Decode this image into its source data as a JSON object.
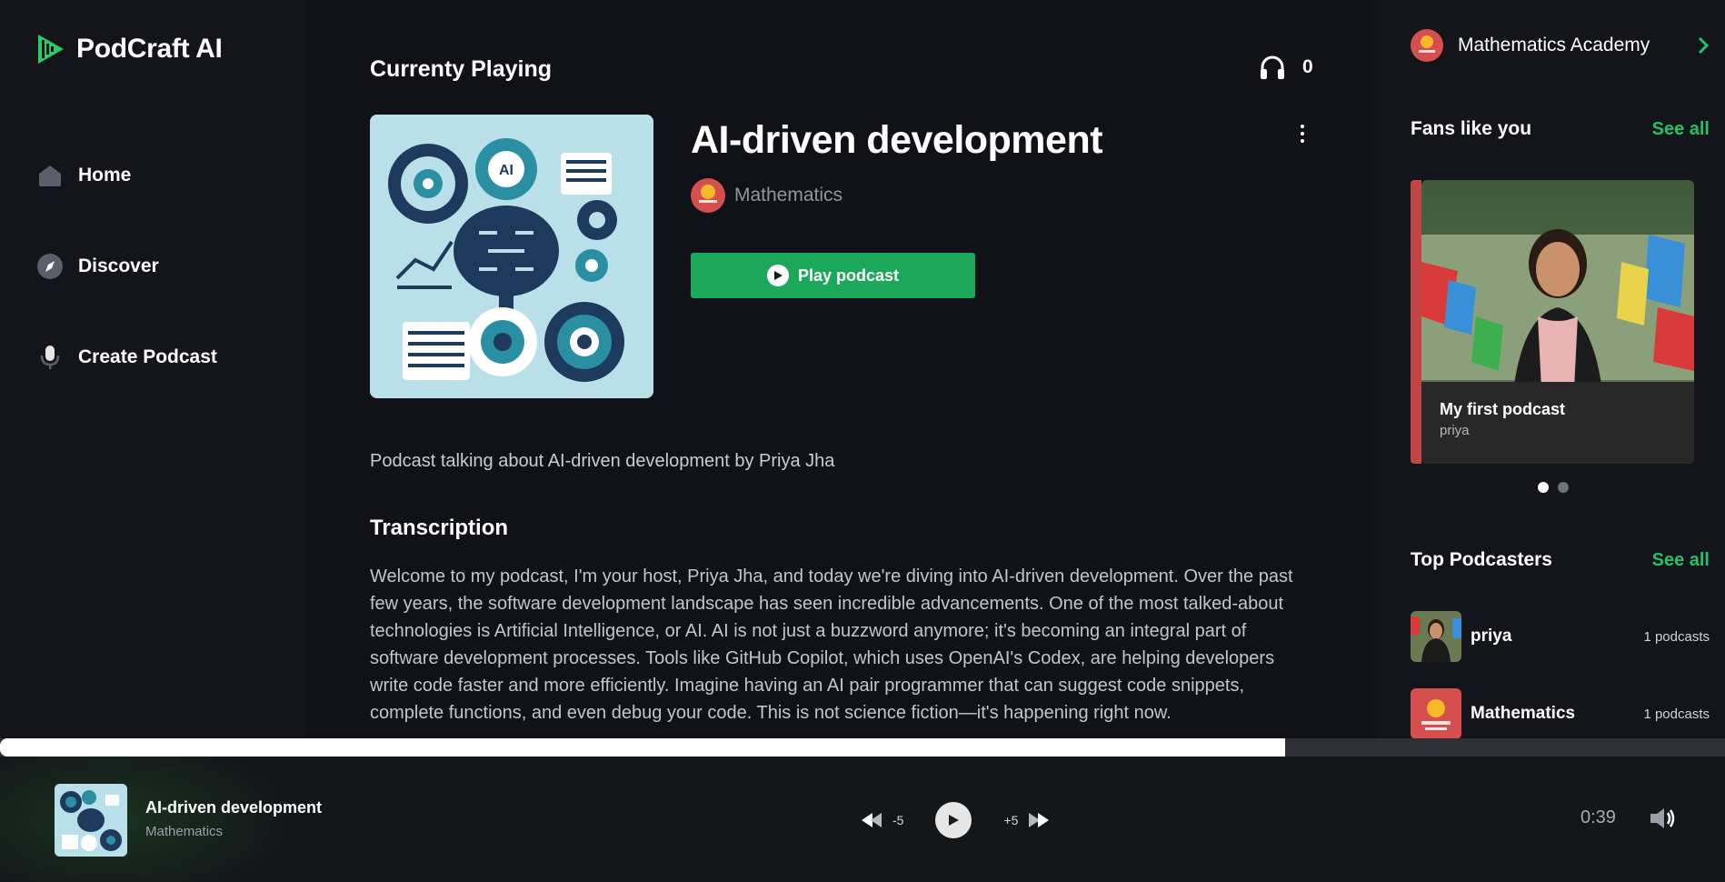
{
  "app": {
    "name": "PodCraft AI"
  },
  "nav": [
    {
      "label": "Home",
      "icon": "home-icon"
    },
    {
      "label": "Discover",
      "icon": "compass-icon"
    },
    {
      "label": "Create Podcast",
      "icon": "microphone-icon"
    }
  ],
  "main": {
    "section_title": "Currenty Playing",
    "listeners": "0",
    "podcast_title": "AI-driven development",
    "author": "Mathematics",
    "play_label": "Play podcast",
    "description": "Podcast talking about AI-driven development by Priya Jha",
    "transcription_title": "Transcription",
    "transcription": "Welcome to my podcast, I'm your host, Priya Jha, and today we're diving into AI-driven development. Over the past few years, the software development landscape has seen incredible advancements. One of the most talked-about technologies is Artificial Intelligence, or AI. AI is not just a buzzword anymore; it's becoming an integral part of software development processes. Tools like GitHub Copilot, which uses OpenAI's Codex, are helping developers write code faster and more efficiently. Imagine having an AI pair programmer that can suggest code snippets, complete functions, and even debug your code. This is not science fiction—it's happening right now."
  },
  "right": {
    "account_name": "Mathematics Academy",
    "fans_title": "Fans like you",
    "fans_see_all": "See all",
    "fan_card": {
      "title": "My first podcast",
      "subtitle": "priya"
    },
    "top_title": "Top Podcasters",
    "top_see_all": "See all",
    "podcasters": [
      {
        "name": "priya",
        "count": "1 podcasts"
      },
      {
        "name": "Mathematics",
        "count": "1 podcasts"
      }
    ]
  },
  "player": {
    "title": "AI-driven development",
    "subtitle": "Mathematics",
    "rewind_label": "-5",
    "forward_label": "+5",
    "time": "0:39",
    "progress": 0.745
  },
  "colors": {
    "accent": "#1ca85a",
    "accent_text": "#22c268",
    "background": "#111217"
  }
}
